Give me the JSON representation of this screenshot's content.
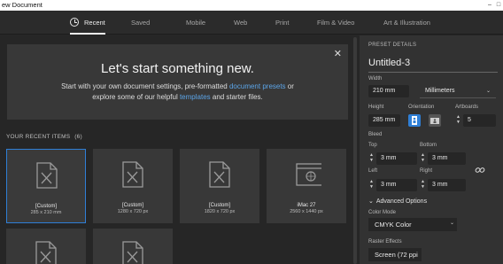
{
  "window": {
    "title": "ew Document"
  },
  "tabs": [
    "Recent",
    "Saved",
    "Mobile",
    "Web",
    "Print",
    "Film & Video",
    "Art & Illustration"
  ],
  "hero": {
    "title": "Let's start something new.",
    "line1_prefix": "Start with your own document settings, pre-formatted ",
    "line1_link": "document presets",
    "line1_suffix": " or",
    "line2_prefix": "explore some of our helpful ",
    "line2_link": "templates",
    "line2_suffix": " and starter files.",
    "close": "✕"
  },
  "recent": {
    "label": "YOUR RECENT ITEMS",
    "count": "(6)",
    "items": [
      {
        "name": "[Custom]",
        "size": "285 x 210 mm"
      },
      {
        "name": "[Custom]",
        "size": "1280 x 720 px"
      },
      {
        "name": "[Custom]",
        "size": "1820 x 720 px"
      },
      {
        "name": "iMac 27",
        "size": "2560 x 1440 px"
      }
    ]
  },
  "details": {
    "header": "PRESET DETAILS",
    "doc_name": "Untitled-3",
    "width_label": "Width",
    "width_value": "210 mm",
    "unit": "Millimeters",
    "height_label": "Height",
    "height_value": "285 mm",
    "orientation_label": "Orientation",
    "artboards_label": "Artboards",
    "artboards_value": "5",
    "bleed_label": "Bleed",
    "top_label": "Top",
    "top_value": "3 mm",
    "bottom_label": "Bottom",
    "bottom_value": "3 mm",
    "left_label": "Left",
    "left_value": "3 mm",
    "right_label": "Right",
    "right_value": "3 mm",
    "advanced": "Advanced Options",
    "color_mode_label": "Color Mode",
    "color_mode_value": "CMYK Color",
    "raster_label": "Raster Effects",
    "raster_value": "Screen (72 ppi"
  },
  "colors": {
    "accent": "#2f7fd6",
    "link": "#5ca5e8"
  }
}
